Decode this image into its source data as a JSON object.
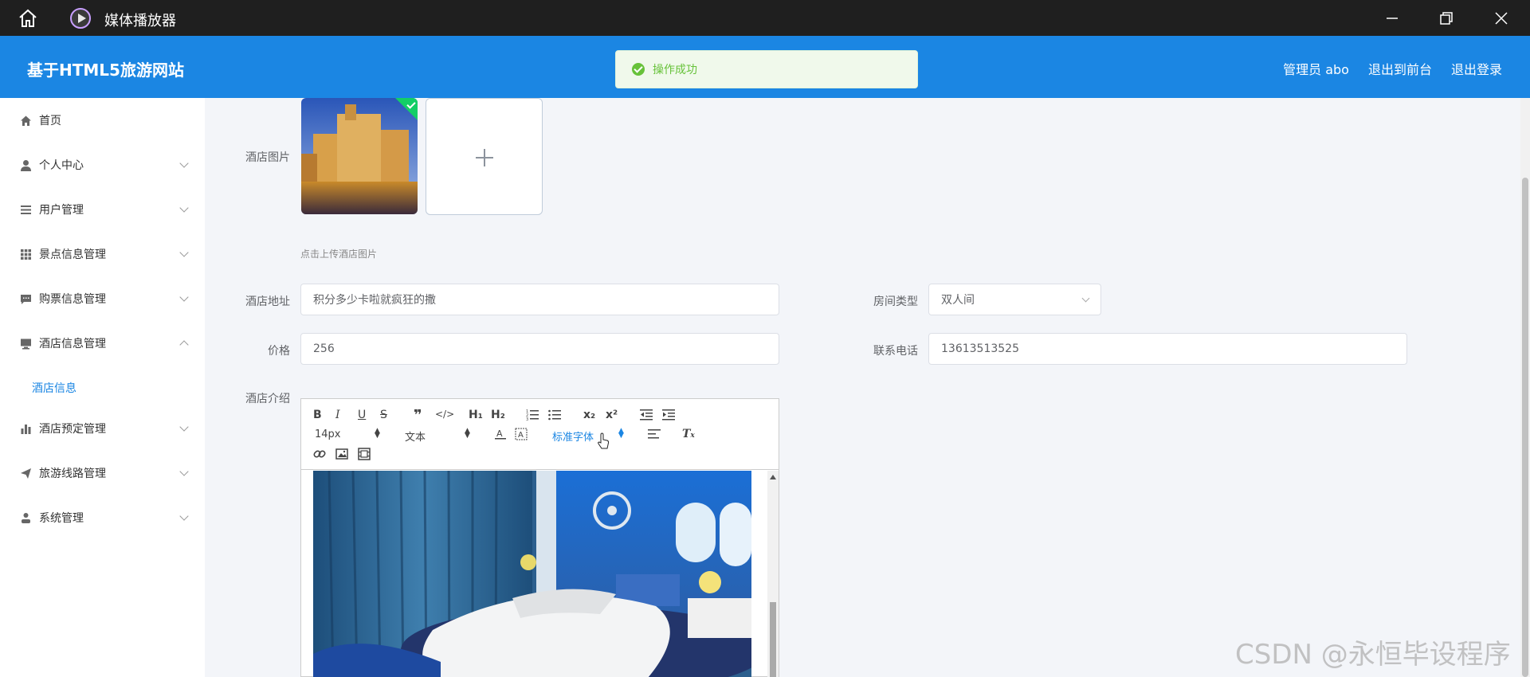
{
  "window": {
    "title": "媒体播放器"
  },
  "header": {
    "site_title": "基于HTML5旅游网站",
    "links": [
      "管理员 abo",
      "退出到前台",
      "退出登录"
    ]
  },
  "toast": {
    "message": "操作成功",
    "color": "#67c23a"
  },
  "sidebar": {
    "items": [
      {
        "label": "首页",
        "icon": "home-icon"
      },
      {
        "label": "个人中心",
        "icon": "user-icon"
      },
      {
        "label": "用户管理",
        "icon": "list-icon"
      },
      {
        "label": "景点信息管理",
        "icon": "grid-icon"
      },
      {
        "label": "购票信息管理",
        "icon": "chat-icon"
      },
      {
        "label": "酒店信息管理",
        "icon": "monitor-icon",
        "expanded": true
      },
      {
        "label": "酒店预定管理",
        "icon": "bar-chart-icon"
      },
      {
        "label": "旅游线路管理",
        "icon": "send-icon"
      },
      {
        "label": "系统管理",
        "icon": "person-icon"
      }
    ],
    "submenu": [
      "酒店信息"
    ],
    "active_color": "#1b86e3"
  },
  "form": {
    "image_label": "酒店图片",
    "upload_tip": "点击上传酒店图片",
    "address_label": "酒店地址",
    "address_value": "积分多少卡啦就疯狂的撒",
    "room_type_label": "房间类型",
    "room_type_value": "双人间",
    "price_label": "价格",
    "price_value": "256",
    "phone_label": "联系电话",
    "phone_value": "13613513525",
    "intro_label": "酒店介绍"
  },
  "editor": {
    "font_size": "14px",
    "header_select": "文本",
    "font_family": "标准字体"
  },
  "watermark": "CSDN @永恒毕设程序",
  "colors": {
    "header": "#1b86e3",
    "titlebar": "#1f1f1f"
  }
}
